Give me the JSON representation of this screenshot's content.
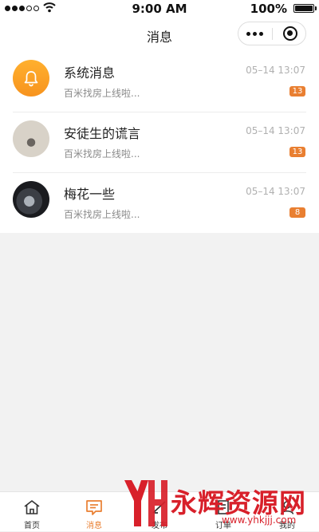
{
  "status_bar": {
    "time": "9:00 AM",
    "battery": "100%"
  },
  "header": {
    "title": "消息"
  },
  "messages": [
    {
      "name": "系统消息",
      "preview": "百米找房上线啦...",
      "time": "05–14  13:07",
      "badge": "13",
      "avatar": "bell-icon"
    },
    {
      "name": "安徒生的谎言",
      "preview": "百米找房上线啦...",
      "time": "05–14  13:07",
      "badge": "13",
      "avatar": "user-photo"
    },
    {
      "name": "梅花一些",
      "preview": "百米找房上线啦...",
      "time": "05–14  13:07",
      "badge": "8",
      "avatar": "user-photo"
    }
  ],
  "tabs": [
    {
      "label": "首页",
      "icon": "home-icon",
      "active": false
    },
    {
      "label": "消息",
      "icon": "message-icon",
      "active": true
    },
    {
      "label": "发布",
      "icon": "publish-icon",
      "active": false
    },
    {
      "label": "订单",
      "icon": "order-icon",
      "active": false
    },
    {
      "label": "我的",
      "icon": "profile-icon",
      "active": false
    }
  ],
  "watermark": {
    "text": "永辉资源网",
    "url": "www.yhkjjj.com"
  },
  "colors": {
    "accent": "#e97f31",
    "system_avatar": "#f7931e",
    "background": "#f2f2f2",
    "watermark": "#d8202a"
  }
}
